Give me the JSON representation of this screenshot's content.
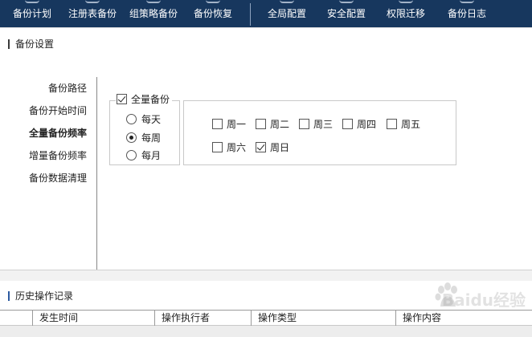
{
  "toolbar": {
    "items": [
      {
        "label": "备份计划"
      },
      {
        "label": "注册表备份"
      },
      {
        "label": "组策略备份"
      },
      {
        "label": "备份恢复"
      },
      {
        "label": "全局配置"
      },
      {
        "label": "安全配置"
      },
      {
        "label": "权限迁移"
      },
      {
        "label": "备份日志"
      }
    ],
    "background": "#17375e"
  },
  "settings": {
    "title": "备份设置",
    "menu": [
      {
        "label": "备份路径"
      },
      {
        "label": "备份开始时间"
      },
      {
        "label": "全量备份频率",
        "active": true
      },
      {
        "label": "增量备份频率"
      },
      {
        "label": "备份数据清理"
      }
    ],
    "full_backup": {
      "label": "全量备份",
      "checked": true,
      "frequency_options": [
        {
          "label": "每天",
          "selected": false
        },
        {
          "label": "每周",
          "selected": true
        },
        {
          "label": "每月",
          "selected": false
        }
      ],
      "days": [
        {
          "label": "周一",
          "checked": false
        },
        {
          "label": "周二",
          "checked": false
        },
        {
          "label": "周三",
          "checked": false
        },
        {
          "label": "周四",
          "checked": false
        },
        {
          "label": "周五",
          "checked": false
        },
        {
          "label": "周六",
          "checked": false
        },
        {
          "label": "周日",
          "checked": true
        }
      ]
    }
  },
  "history": {
    "title": "历史操作记录",
    "columns": [
      {
        "label": ""
      },
      {
        "label": "发生时间"
      },
      {
        "label": "操作执行者"
      },
      {
        "label": "操作类型"
      },
      {
        "label": "操作内容"
      }
    ]
  },
  "watermark": {
    "text": "Baidu经验"
  }
}
